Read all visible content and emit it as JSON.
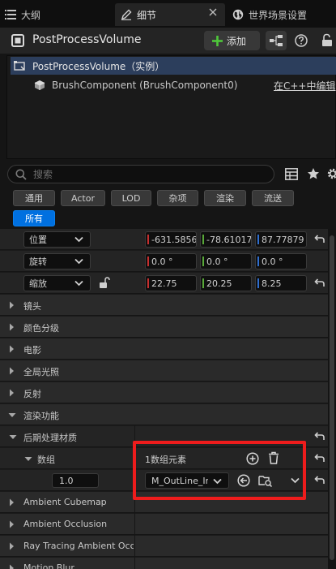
{
  "tabs": [
    {
      "label": "大纲"
    },
    {
      "label": "细节"
    },
    {
      "label": "世界场景设置"
    }
  ],
  "actor_title": "PostProcessVolume",
  "toolbar": {
    "add_label": "添加"
  },
  "components": [
    {
      "label": "PostProcessVolume（实例）"
    },
    {
      "label": "BrushComponent (BrushComponent0)",
      "link": "在C++中编辑"
    }
  ],
  "search": {
    "placeholder": "搜索"
  },
  "filters": [
    "通用",
    "Actor",
    "LOD",
    "杂项",
    "渲染",
    "流送",
    "所有"
  ],
  "transform": {
    "location": {
      "label": "位置",
      "x": "-631.5856",
      "y": "-78.61017",
      "z": "87.77879"
    },
    "rotation": {
      "label": "旋转",
      "x": "0.0 °",
      "y": "0.0 °",
      "z": "0.0 °"
    },
    "scale": {
      "label": "缩放",
      "x": "22.75",
      "y": "20.25",
      "z": "8.25"
    }
  },
  "sections": [
    "镜头",
    "颜色分级",
    "电影",
    "全局光照",
    "反射",
    "渲染功能"
  ],
  "material": {
    "header": "后期处理材质",
    "array_label": "数组",
    "array_count": "1数组元素",
    "weight": "1.0",
    "asset": "M_OutLine_Ins"
  },
  "subsections": [
    "Ambient Cubemap",
    "Ambient Occlusion",
    "Ray Tracing Ambient Occlu",
    "Motion Blur"
  ],
  "colors": {
    "accent": "#0070e0",
    "highlight": "#ee1c1c",
    "axis_x": "#c52f2f",
    "axis_y": "#58a838",
    "axis_z": "#2f6ecf"
  }
}
